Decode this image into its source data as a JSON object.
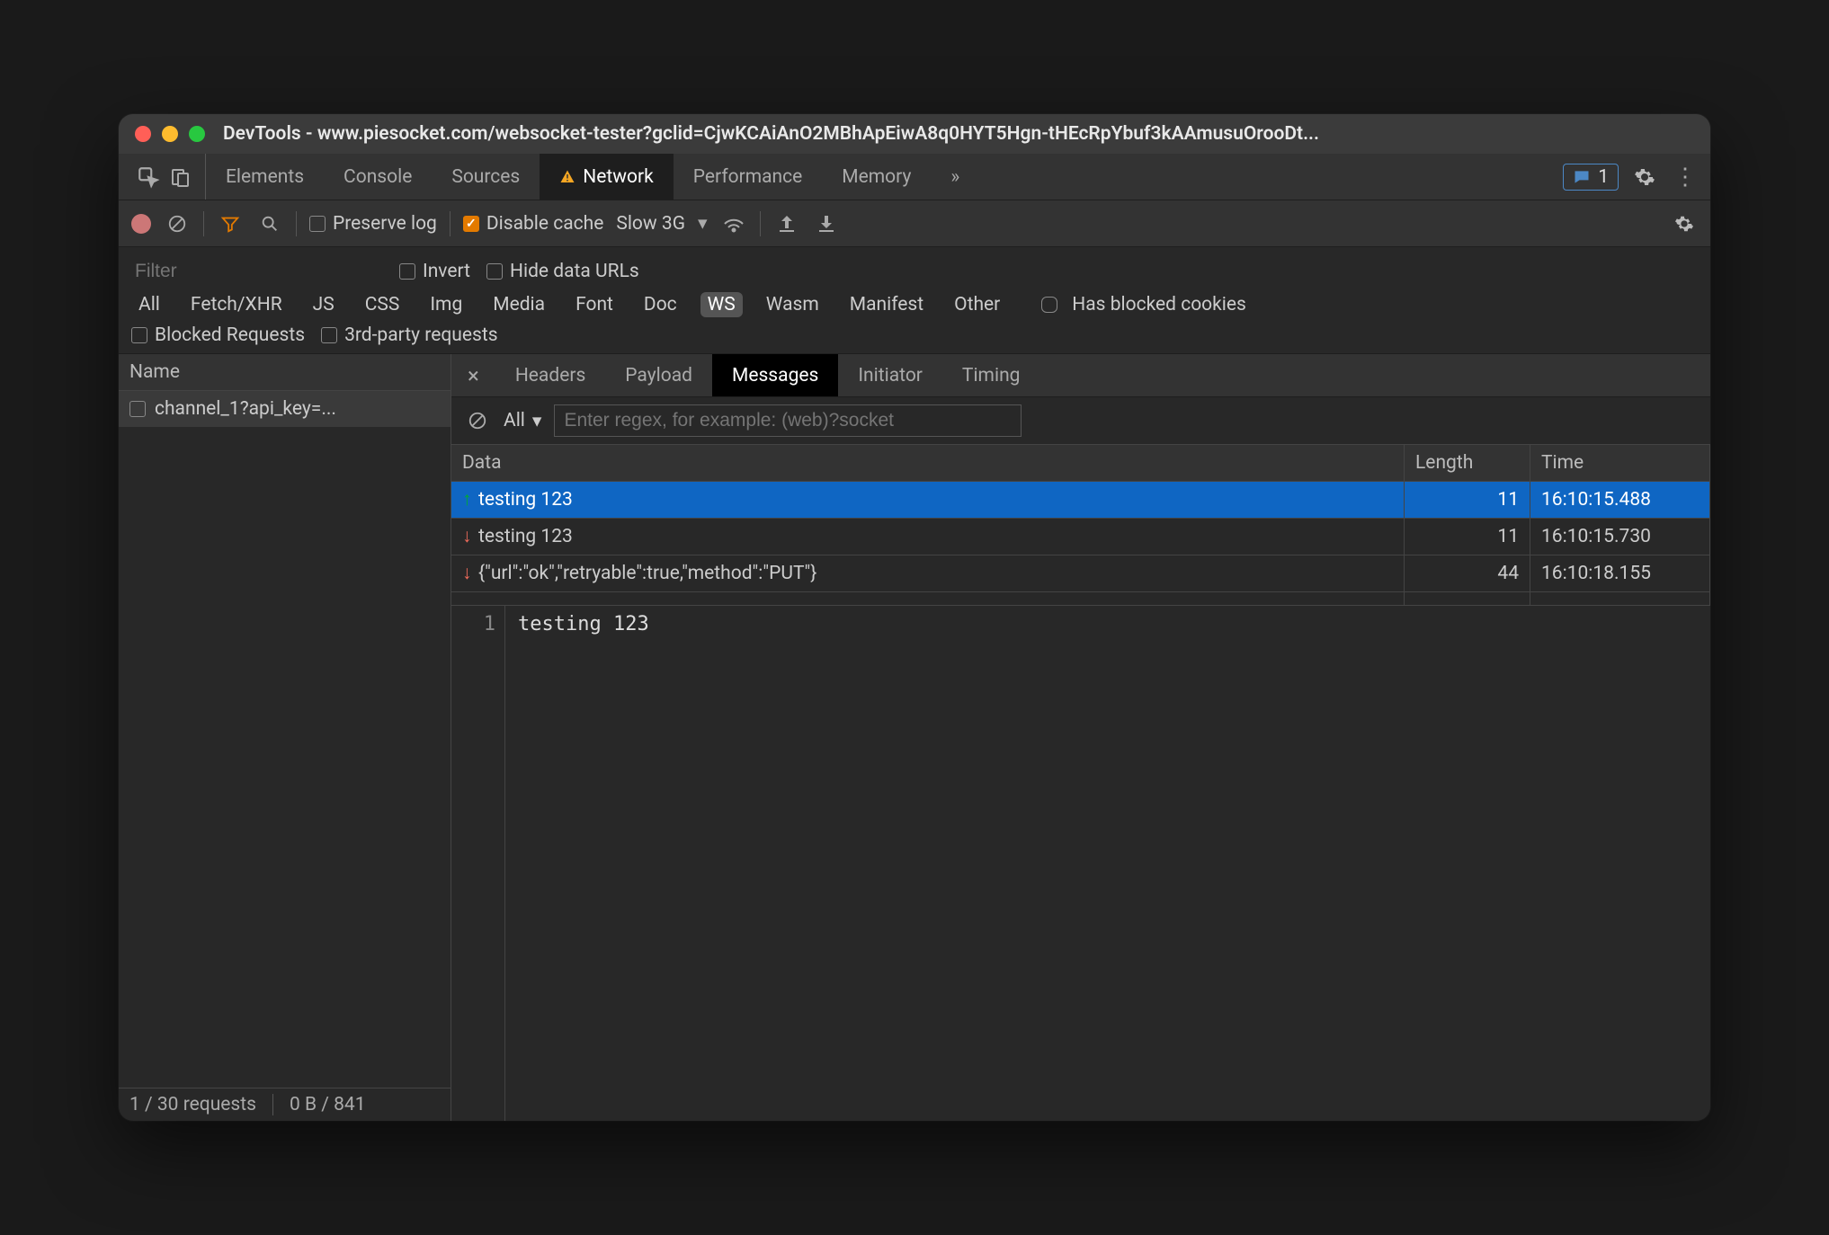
{
  "title": "DevTools - www.piesocket.com/websocket-tester?gclid=CjwKCAiAnO2MBhApEiwA8q0HYT5Hgn-tHEcRpYbuf3kAAmusuOrooDt...",
  "top_tabs": [
    "Elements",
    "Console",
    "Sources",
    "Network",
    "Performance",
    "Memory"
  ],
  "active_top_tab": "Network",
  "issues_count": "1",
  "toolbar": {
    "preserve_log": "Preserve log",
    "disable_cache": "Disable cache",
    "throttling": "Slow 3G"
  },
  "filters": {
    "placeholder": "Filter",
    "invert": "Invert",
    "hide_data_urls": "Hide data URLs",
    "types": [
      "All",
      "Fetch/XHR",
      "JS",
      "CSS",
      "Img",
      "Media",
      "Font",
      "Doc",
      "WS",
      "Wasm",
      "Manifest",
      "Other"
    ],
    "selected_type": "WS",
    "has_blocked_cookies": "Has blocked cookies",
    "blocked_requests": "Blocked Requests",
    "third_party": "3rd-party requests"
  },
  "sidebar": {
    "header": "Name",
    "items": [
      "channel_1?api_key=..."
    ],
    "status": {
      "requests": "1 / 30 requests",
      "transfer": "0 B / 841"
    }
  },
  "detail_tabs": [
    "Headers",
    "Payload",
    "Messages",
    "Initiator",
    "Timing"
  ],
  "active_detail_tab": "Messages",
  "msg_toolbar": {
    "filter_all": "All",
    "regex_placeholder": "Enter regex, for example: (web)?socket"
  },
  "msg_columns": {
    "data": "Data",
    "length": "Length",
    "time": "Time"
  },
  "messages": [
    {
      "dir": "up",
      "data": "testing 123",
      "length": "11",
      "time": "16:10:15.488",
      "selected": true
    },
    {
      "dir": "down",
      "data": "testing 123",
      "length": "11",
      "time": "16:10:15.730"
    },
    {
      "dir": "down",
      "data": "{\"url\":\"ok\",\"retryable\":true,\"method\":\"PUT\"}",
      "length": "44",
      "time": "16:10:18.155"
    }
  ],
  "payload": {
    "line": "1",
    "text": "testing 123"
  }
}
